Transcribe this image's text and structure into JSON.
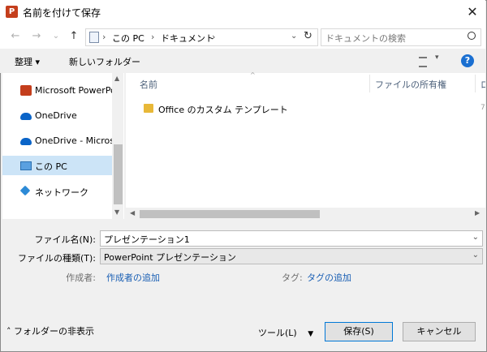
{
  "window": {
    "title": "名前を付けて保存",
    "app_icon": "P"
  },
  "nav": {
    "back": "←",
    "forward": "→",
    "dropdown": "⌄",
    "up": "↑",
    "path": [
      "この PC",
      "ドキュメント"
    ],
    "path_sep": "›",
    "refresh": "↻",
    "search_placeholder": "ドキュメントの検索"
  },
  "toolbar": {
    "organize": "整理 ▾",
    "new_folder": "新しいフォルダー",
    "view_arrow": "▾",
    "help": "?"
  },
  "sidebar": {
    "items": [
      {
        "label": "Microsoft PowerPoint",
        "icon": "powerpoint-icon"
      },
      {
        "label": "OneDrive",
        "icon": "cloud-icon"
      },
      {
        "label": "OneDrive - Microsoft",
        "icon": "cloud-icon"
      },
      {
        "label": "この PC",
        "icon": "computer-icon",
        "selected": true
      },
      {
        "label": "ネットワーク",
        "icon": "network-icon"
      }
    ]
  },
  "files": {
    "columns": [
      "名前",
      "ファイルの所有権",
      "ロ"
    ],
    "rows": [
      {
        "name": "Office のカスタム テンプレート",
        "owner": "",
        "trail": "7"
      }
    ]
  },
  "form": {
    "filename_label": "ファイル名(N):",
    "filename_value": "プレゼンテーション1",
    "filetype_label": "ファイルの種類(T):",
    "filetype_value": "PowerPoint プレゼンテーション",
    "author_label": "作成者:",
    "author_link": "作成者の追加",
    "tags_label": "タグ:",
    "tags_link": "タグの追加"
  },
  "footer": {
    "hide_folders": "フォルダーの非表示",
    "tools": "ツール(L)",
    "save": "保存(S)",
    "cancel": "キャンセル"
  },
  "colors": {
    "accent": "#1a6fd1",
    "selected": "#cce4f7",
    "ppt": "#c43e1c",
    "folder": "#e8b838"
  }
}
